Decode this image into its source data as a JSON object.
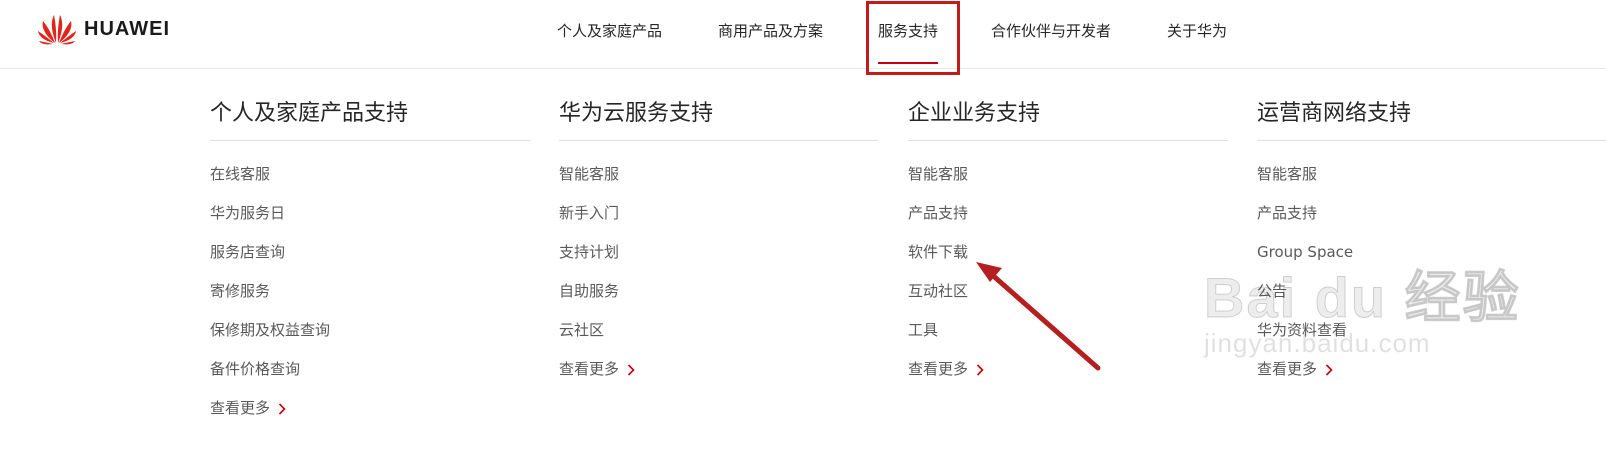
{
  "brand": {
    "name": "HUAWEI",
    "logo_color": "#e1251b"
  },
  "nav": {
    "items": [
      "个人及家庭产品",
      "商用产品及方案",
      "服务支持",
      "合作伙伴与开发者",
      "关于华为"
    ],
    "active_index": 2,
    "accent": "#c7000b"
  },
  "menu": {
    "columns": [
      {
        "title": "个人及家庭产品支持",
        "links": [
          "在线客服",
          "华为服务日",
          "服务店查询",
          "寄修服务",
          "保修期及权益查询",
          "备件价格查询"
        ],
        "more": "查看更多"
      },
      {
        "title": "华为云服务支持",
        "links": [
          "智能客服",
          "新手入门",
          "支持计划",
          "自助服务",
          "云社区"
        ],
        "more": "查看更多"
      },
      {
        "title": "企业业务支持",
        "links": [
          "智能客服",
          "产品支持",
          "软件下载",
          "互动社区",
          "工具"
        ],
        "more": "查看更多"
      },
      {
        "title": "运营商网络支持",
        "links": [
          "智能客服",
          "产品支持",
          "Group Space",
          "公告",
          "华为资料查看"
        ],
        "more": "查看更多"
      }
    ]
  },
  "annotation": {
    "color": "#b42020",
    "target": "软件下载"
  },
  "watermark": {
    "brand": "Bai du 经验",
    "url": "jingyan.baidu.com"
  }
}
